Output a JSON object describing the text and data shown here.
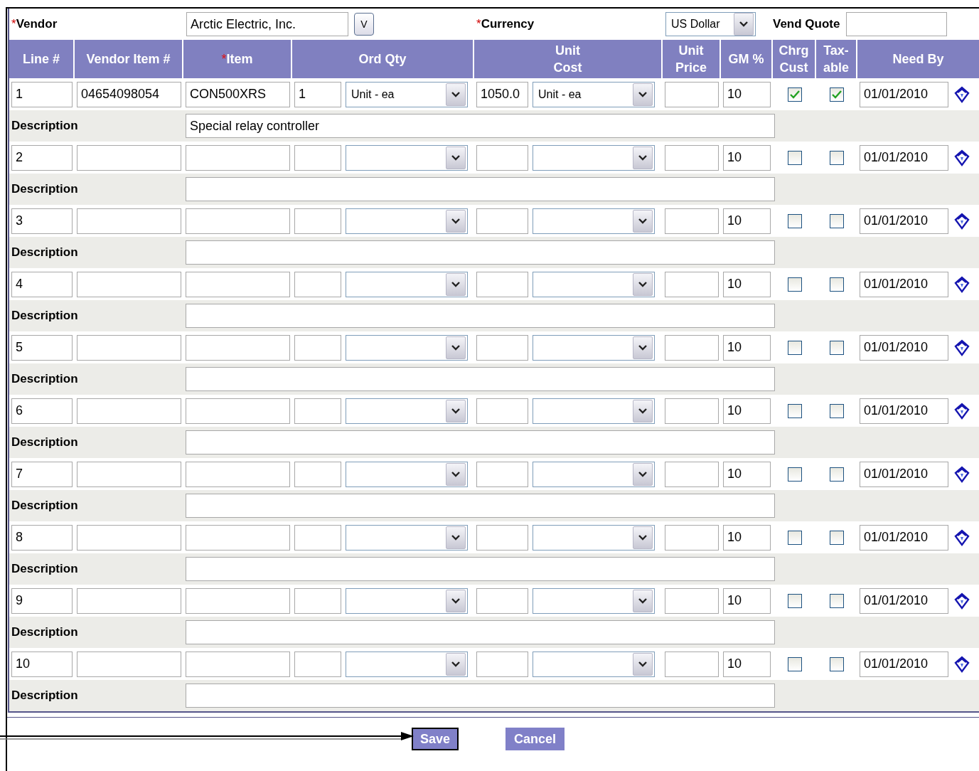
{
  "vendor": {
    "required_mark": "*",
    "label": "Vendor",
    "value": "Arctic Electric, Inc.",
    "lookup_button": "V"
  },
  "currency": {
    "required_mark": "*",
    "label": "Currency",
    "value": "US Dollar"
  },
  "vend_quote": {
    "label": "Vend Quote"
  },
  "columns": [
    {
      "label": "Line #"
    },
    {
      "label": "Vendor Item #"
    },
    {
      "label": "Item",
      "required_mark": "*"
    },
    {
      "label": "Ord Qty"
    },
    {
      "label": "Unit\nCost"
    },
    {
      "label": "Unit\nPrice"
    },
    {
      "label": "GM %"
    },
    {
      "label": "Chrg\nCust"
    },
    {
      "label": "Tax-\nable"
    },
    {
      "label": "Need By"
    }
  ],
  "rows": [
    {
      "line": "1",
      "vendor_item": "04654098054",
      "item": "CON500XRS",
      "qty": "1",
      "qty_uom": "Unit - ea",
      "unit_cost": "1050.0",
      "cost_uom": "Unit - ea",
      "gm": "10",
      "chrg_cust": true,
      "taxable": true,
      "need_by": "01/01/2010",
      "description_label": "Description",
      "description": "Special relay controller"
    },
    {
      "line": "2",
      "gm": "10",
      "chrg_cust": false,
      "taxable": false,
      "need_by": "01/01/2010",
      "description_label": "Description"
    },
    {
      "line": "3",
      "gm": "10",
      "chrg_cust": false,
      "taxable": false,
      "need_by": "01/01/2010",
      "description_label": "Description"
    },
    {
      "line": "4",
      "gm": "10",
      "chrg_cust": false,
      "taxable": false,
      "need_by": "01/01/2010",
      "description_label": "Description"
    },
    {
      "line": "5",
      "gm": "10",
      "chrg_cust": false,
      "taxable": false,
      "need_by": "01/01/2010",
      "description_label": "Description"
    },
    {
      "line": "6",
      "gm": "10",
      "chrg_cust": false,
      "taxable": false,
      "need_by": "01/01/2010",
      "description_label": "Description"
    },
    {
      "line": "7",
      "gm": "10",
      "chrg_cust": false,
      "taxable": false,
      "need_by": "01/01/2010",
      "description_label": "Description"
    },
    {
      "line": "8",
      "gm": "10",
      "chrg_cust": false,
      "taxable": false,
      "need_by": "01/01/2010",
      "description_label": "Description"
    },
    {
      "line": "9",
      "gm": "10",
      "chrg_cust": false,
      "taxable": false,
      "need_by": "01/01/2010",
      "description_label": "Description"
    },
    {
      "line": "10",
      "gm": "10",
      "chrg_cust": false,
      "taxable": false,
      "need_by": "01/01/2010",
      "description_label": "Description"
    }
  ],
  "buttons": [
    {
      "label": "Save",
      "selected": true
    },
    {
      "label": "Cancel",
      "selected": false
    }
  ]
}
